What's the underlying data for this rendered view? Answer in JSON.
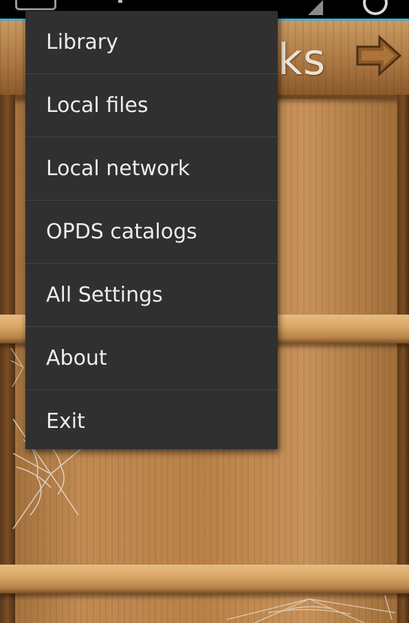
{
  "status_bar": {
    "icons": [
      "app-icon",
      "signal-icon",
      "sync-icon"
    ]
  },
  "header": {
    "title_visible": "ks",
    "next_button_icon": "arrow-right-icon"
  },
  "menu": {
    "items": [
      {
        "label": "Library"
      },
      {
        "label": "Local files"
      },
      {
        "label": "Local network"
      },
      {
        "label": "OPDS catalogs"
      },
      {
        "label": "All Settings"
      },
      {
        "label": "About"
      },
      {
        "label": "Exit"
      }
    ]
  },
  "colors": {
    "status_accent": "#33b5e5",
    "menu_background": "#303030",
    "menu_text": "#ededed",
    "wood": "#b98148"
  }
}
